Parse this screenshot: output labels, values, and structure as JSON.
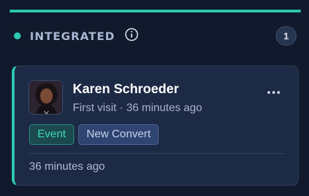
{
  "colors": {
    "accent": "#2cc9b2",
    "background": "#111a2c",
    "card": "#1d2a45"
  },
  "column": {
    "title": "INTEGRATED",
    "info_icon": "info-circle-icon",
    "count": "1"
  },
  "card": {
    "name": "Karen Schroeder",
    "subtitle": "First visit · 36 minutes ago",
    "more_icon": "more-horizontal-icon",
    "tags": [
      {
        "label": "Event"
      },
      {
        "label": "New Convert"
      }
    ],
    "footer_time": "36 minutes ago"
  }
}
